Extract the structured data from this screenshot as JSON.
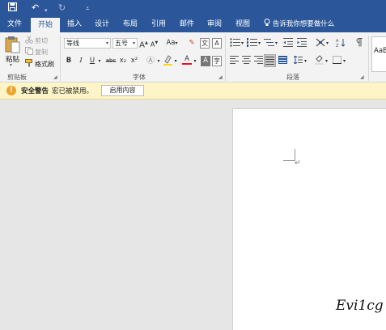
{
  "quick_access": {
    "save_icon": "save-icon",
    "undo_icon": "undo-icon",
    "redo_icon": "redo-icon",
    "customize_icon": "customize-icon"
  },
  "tabs": [
    {
      "label": "文件"
    },
    {
      "label": "开始"
    },
    {
      "label": "插入"
    },
    {
      "label": "设计"
    },
    {
      "label": "布局"
    },
    {
      "label": "引用"
    },
    {
      "label": "邮件"
    },
    {
      "label": "审阅"
    },
    {
      "label": "视图"
    }
  ],
  "tell_me": "告诉我你想要做什么",
  "clipboard": {
    "paste_label": "粘贴",
    "cut_label": "剪切",
    "copy_label": "复制",
    "format_painter_label": "格式刷",
    "group_label": "剪贴板"
  },
  "font": {
    "font_name": "等线",
    "font_size": "五号",
    "group_label": "字体",
    "grow": "A",
    "shrink": "A",
    "case": "Aa",
    "bold": "B",
    "italic": "I",
    "underline": "U",
    "strike": "abc",
    "subscript": "x₂",
    "superscript": "x²",
    "font_color": "A",
    "char_shading": "A"
  },
  "paragraph": {
    "group_label": "段落"
  },
  "styles": {
    "preview": "AaB"
  },
  "security": {
    "title": "安全警告",
    "message": "宏已被禁用。",
    "button": "启用内容"
  },
  "document": {
    "paragraph_mark": "↵"
  },
  "watermark": "Evi1cg",
  "colors": {
    "accent": "#2b579a",
    "ribbon": "#f3f3f3",
    "warning_bar": "#fdf5c8",
    "font_color_bar": "#e81123",
    "highlight_bar": "#ffd800"
  }
}
